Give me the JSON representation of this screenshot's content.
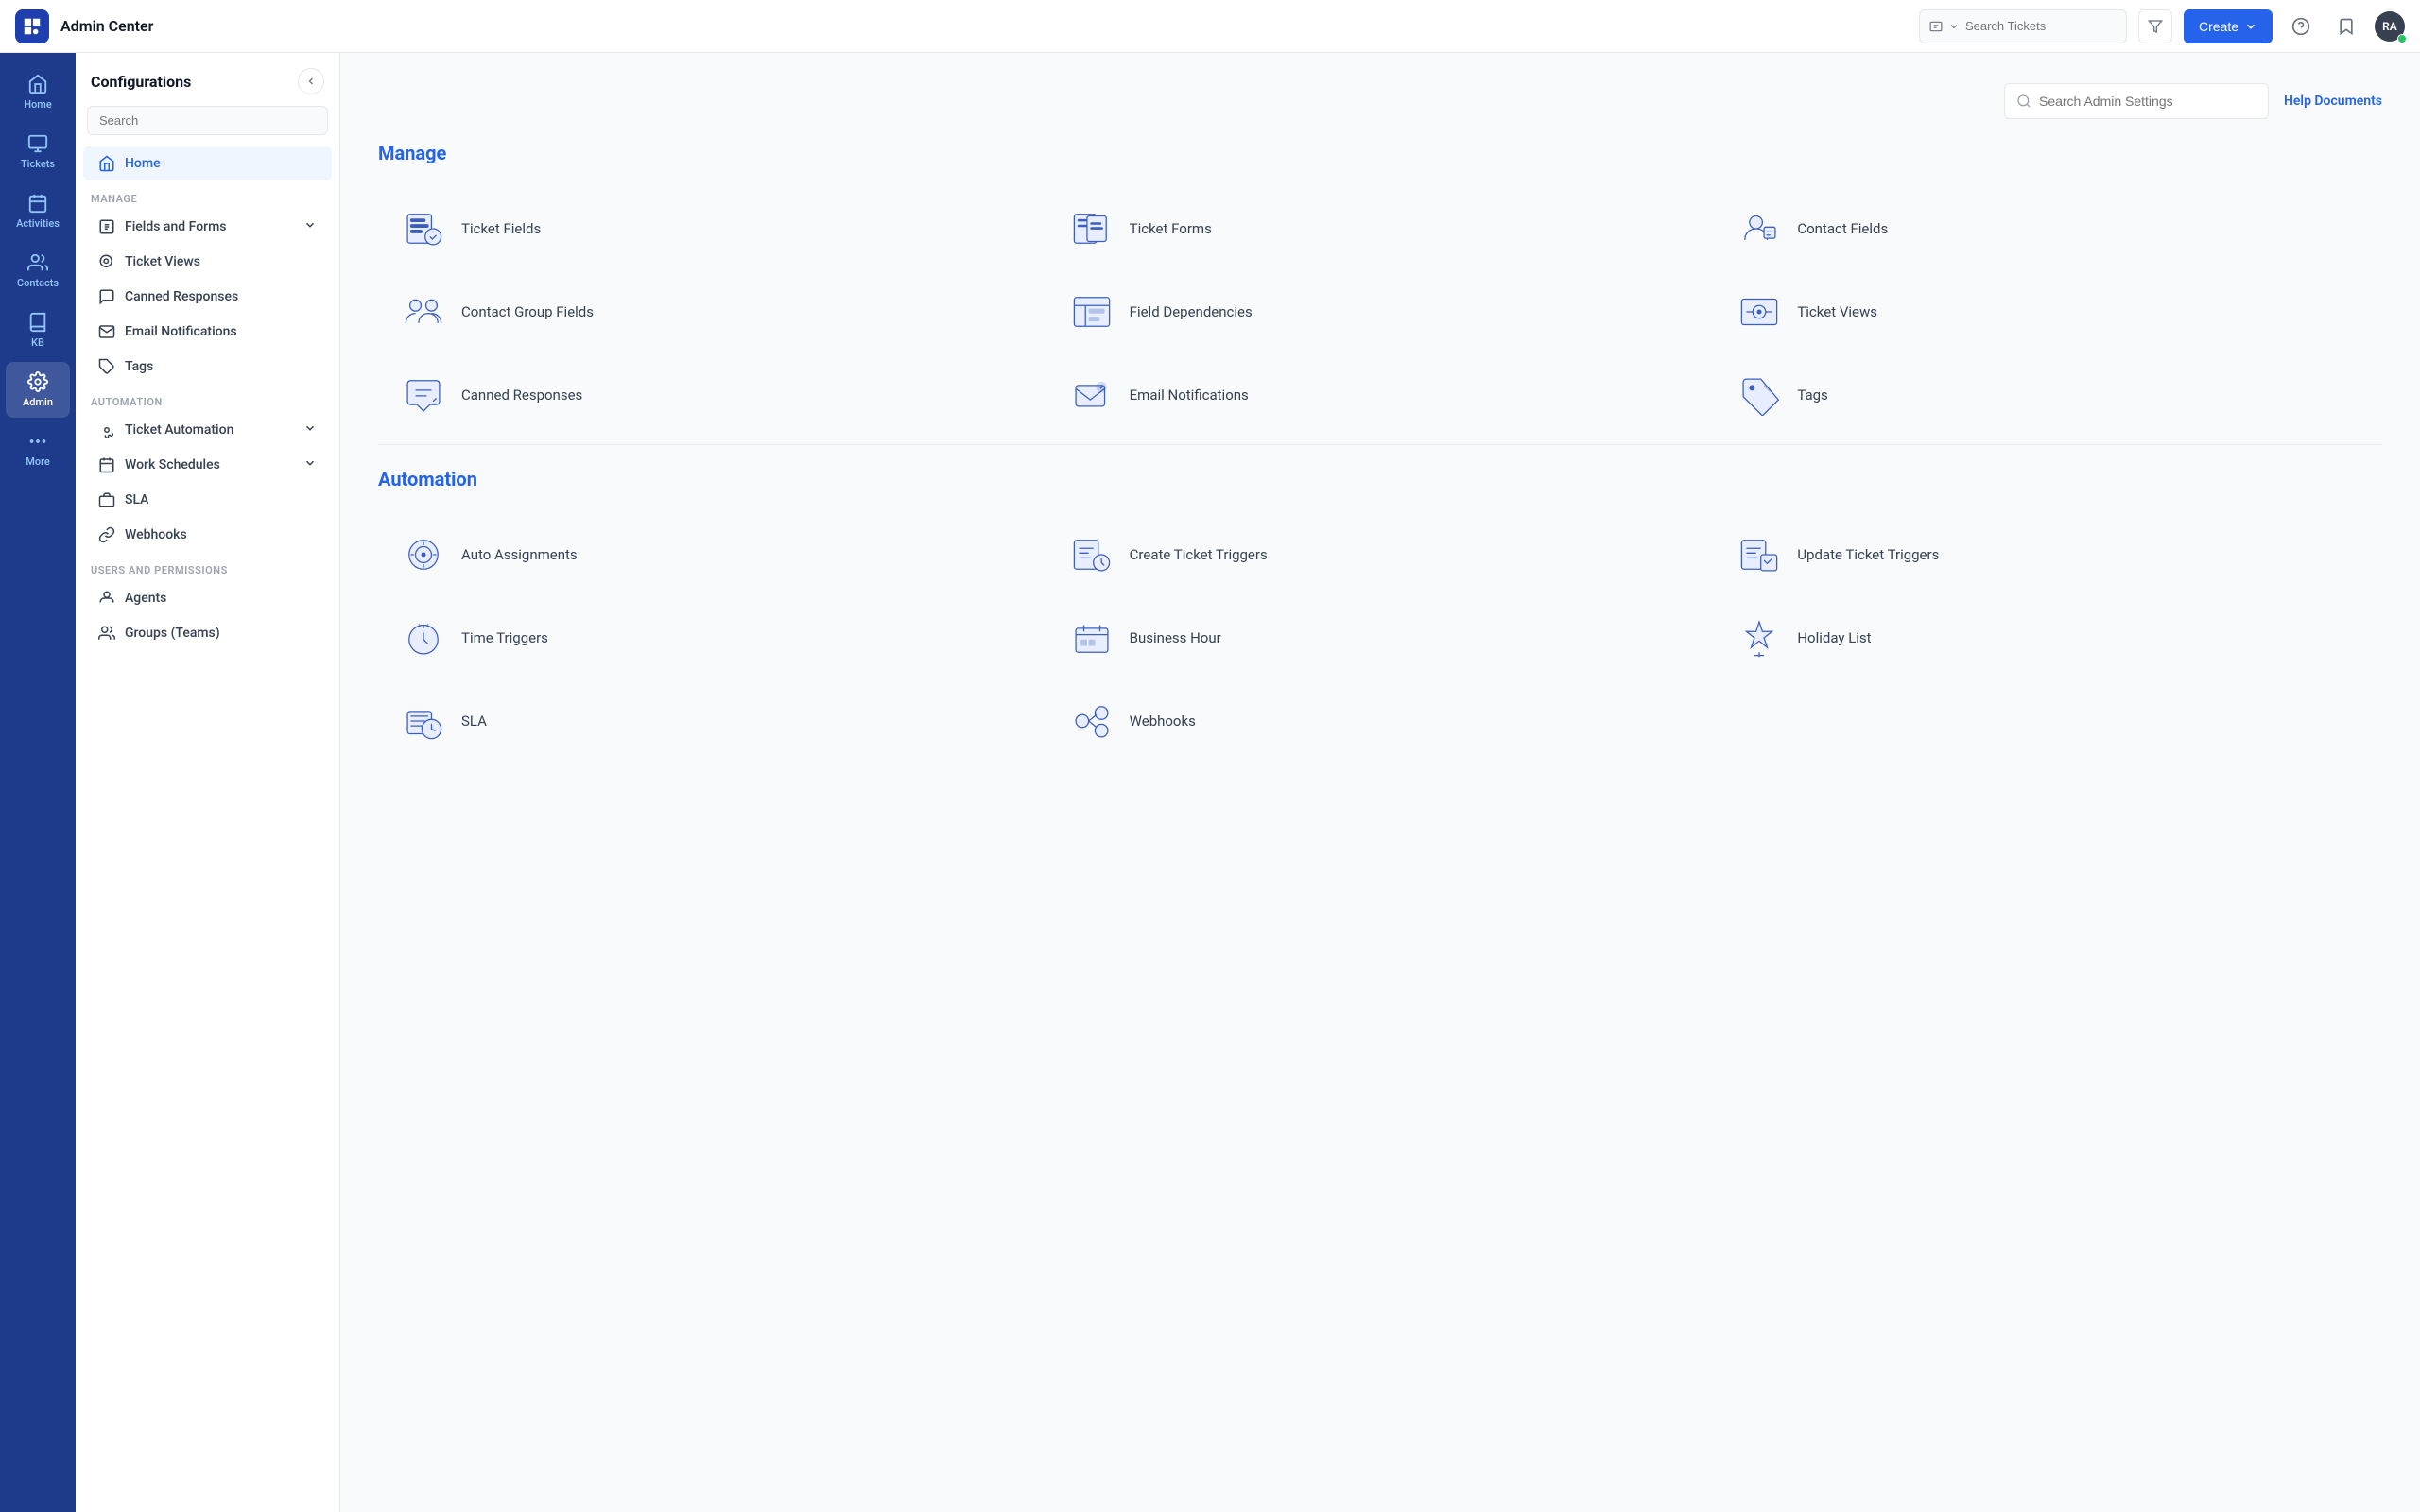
{
  "topbar": {
    "title": "Admin Center",
    "search_placeholder": "Search Tickets",
    "create_label": "Create",
    "avatar_initials": "RA"
  },
  "left_nav": {
    "items": [
      {
        "id": "home",
        "label": "Home",
        "active": false
      },
      {
        "id": "tickets",
        "label": "Tickets",
        "active": false
      },
      {
        "id": "activities",
        "label": "Activities",
        "active": false
      },
      {
        "id": "contacts",
        "label": "Contacts",
        "active": false
      },
      {
        "id": "kb",
        "label": "KB",
        "active": false
      },
      {
        "id": "admin",
        "label": "Admin",
        "active": true
      },
      {
        "id": "more",
        "label": "More",
        "active": false
      }
    ]
  },
  "sidebar": {
    "title": "Configurations",
    "search_placeholder": "Search",
    "home_label": "Home",
    "sections": [
      {
        "id": "manage",
        "label": "MANAGE",
        "items": [
          {
            "id": "fields-forms",
            "label": "Fields and Forms",
            "has_chevron": true
          },
          {
            "id": "ticket-views",
            "label": "Ticket Views",
            "has_chevron": false
          },
          {
            "id": "canned-responses",
            "label": "Canned Responses",
            "has_chevron": false
          },
          {
            "id": "email-notifications",
            "label": "Email Notifications",
            "has_chevron": false
          },
          {
            "id": "tags",
            "label": "Tags",
            "has_chevron": false
          }
        ]
      },
      {
        "id": "automation",
        "label": "AUTOMATION",
        "items": [
          {
            "id": "ticket-automation",
            "label": "Ticket Automation",
            "has_chevron": true
          },
          {
            "id": "work-schedules",
            "label": "Work Schedules",
            "has_chevron": true
          },
          {
            "id": "sla",
            "label": "SLA",
            "has_chevron": false
          },
          {
            "id": "webhooks",
            "label": "Webhooks",
            "has_chevron": false
          }
        ]
      },
      {
        "id": "users-permissions",
        "label": "USERS AND PERMISSIONS",
        "items": [
          {
            "id": "agents",
            "label": "Agents",
            "has_chevron": false
          },
          {
            "id": "groups-teams",
            "label": "Groups (Teams)",
            "has_chevron": false
          }
        ]
      }
    ]
  },
  "main": {
    "admin_search_placeholder": "Search Admin Settings",
    "help_link": "Help Documents",
    "manage_section": {
      "title": "Manage",
      "cards": [
        {
          "id": "ticket-fields",
          "label": "Ticket Fields"
        },
        {
          "id": "ticket-forms",
          "label": "Ticket Forms"
        },
        {
          "id": "contact-fields",
          "label": "Contact Fields"
        },
        {
          "id": "contact-group-fields",
          "label": "Contact Group Fields"
        },
        {
          "id": "field-dependencies",
          "label": "Field Dependencies"
        },
        {
          "id": "ticket-views",
          "label": "Ticket Views"
        },
        {
          "id": "canned-responses",
          "label": "Canned Responses"
        },
        {
          "id": "email-notifications",
          "label": "Email Notifications"
        },
        {
          "id": "tags",
          "label": "Tags"
        }
      ]
    },
    "automation_section": {
      "title": "Automation",
      "cards": [
        {
          "id": "auto-assignments",
          "label": "Auto Assignments"
        },
        {
          "id": "create-ticket-triggers",
          "label": "Create Ticket Triggers"
        },
        {
          "id": "update-ticket-triggers",
          "label": "Update Ticket Triggers"
        },
        {
          "id": "time-triggers",
          "label": "Time Triggers"
        },
        {
          "id": "business-hour",
          "label": "Business Hour"
        },
        {
          "id": "holiday-list",
          "label": "Holiday List"
        },
        {
          "id": "sla",
          "label": "SLA"
        },
        {
          "id": "webhooks",
          "label": "Webhooks"
        }
      ]
    }
  }
}
